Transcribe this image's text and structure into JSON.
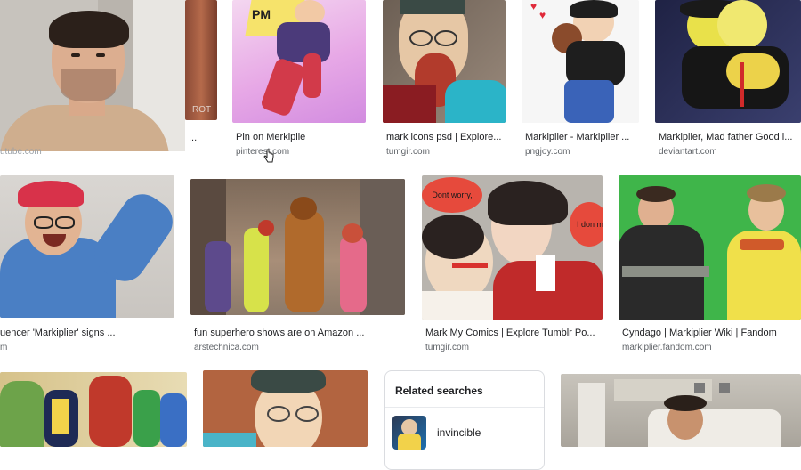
{
  "results_row1": [
    {
      "title": "...",
      "source": ""
    },
    {
      "title": "Pin on Merkiplie",
      "source": "pinterest.com"
    },
    {
      "title": "mark icons psd | Explore...",
      "source": "tumgir.com"
    },
    {
      "title": "Markiplier - Markiplier ...",
      "source": "pngjoy.com"
    },
    {
      "title": "Markiplier, Mad father Good l...",
      "source": "deviantart.com"
    }
  ],
  "results_row2": [
    {
      "title": "uencer 'Markiplier' signs ...",
      "source": "m"
    },
    {
      "title": "fun superhero shows are on Amazon ...",
      "source": "arstechnica.com"
    },
    {
      "title": "Mark My Comics | Explore Tumblr Po...",
      "source": "tumgir.com"
    },
    {
      "title": "Cyndago | Markiplier Wiki | Fandom",
      "source": "markiplier.fandom.com"
    }
  ],
  "webcam_caption": "utube.com",
  "comic_text": {
    "bubble1": "Dont worry,",
    "bubble2": "I don mi"
  },
  "related": {
    "heading": "Related searches",
    "items": [
      {
        "label": "invincible"
      }
    ]
  },
  "colors": {
    "link": "#5f6368",
    "title": "#202124",
    "accent_green": "#3fb54a"
  }
}
